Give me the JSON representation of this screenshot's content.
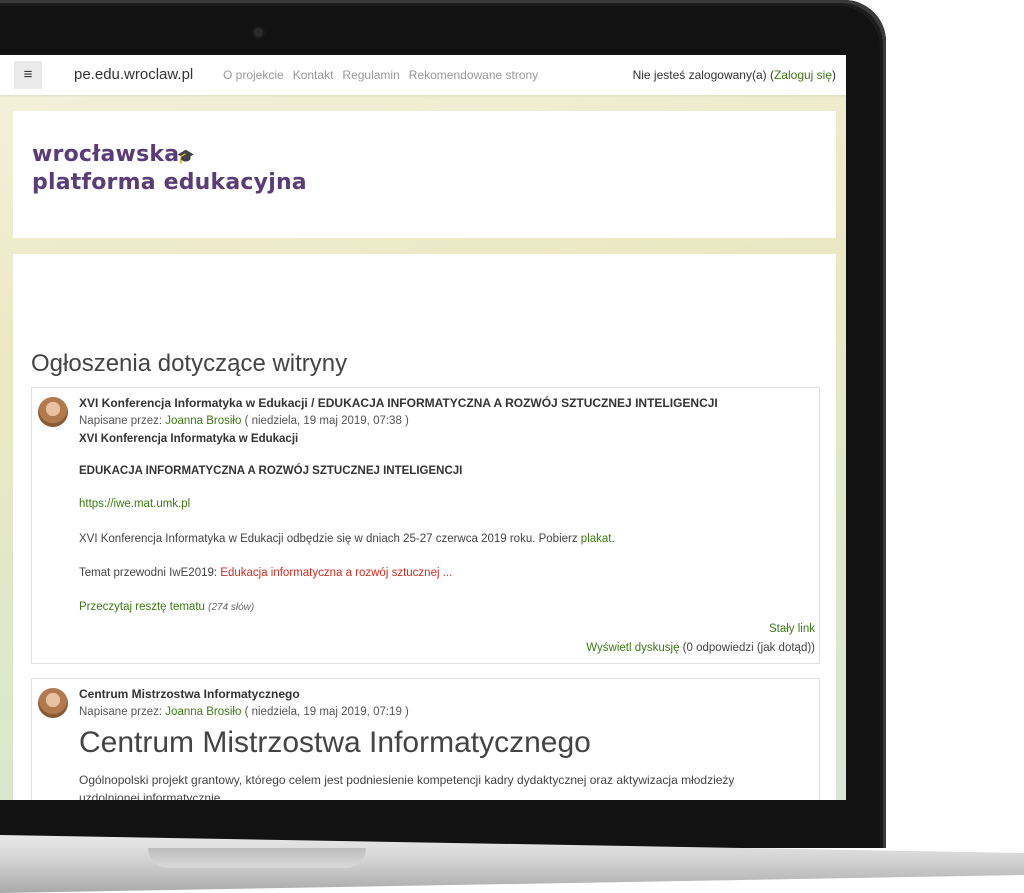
{
  "navbar": {
    "menu_icon": "≡",
    "brand": "pe.edu.wroclaw.pl",
    "links": [
      "O projekcie",
      "Kontakt",
      "Regulamin",
      "Rekomendowane strony"
    ],
    "login_prefix": "Nie jesteś zalogowany(a) (",
    "login_link": "Zaloguj się",
    "login_suffix": ")"
  },
  "logo": {
    "line1": "wrocławska",
    "line2": "platforma edukacyjna",
    "cap_icon": "🎓"
  },
  "section_title": "Ogłoszenia dotyczące witryny",
  "posts": [
    {
      "subject": "XVI Konferencja Informatyka w Edukacji / EDUKACJA INFORMATYCZNA A ROZWÓJ SZTUCZNEJ INTELIGENCJI",
      "by_prefix": "Napisane przez: ",
      "author": "Joanna Brosiło",
      "date": " ( niedziela, 19 maj 2019, 07:38 )",
      "heading1": "XVI Konferencja Informatyka w Edukacji",
      "heading2": "EDUKACJA INFORMATYCZNA A ROZWÓJ SZTUCZNEJ INTELIGENCJI",
      "url": "https://iwe.mat.umk.pl",
      "para_prefix": "XVI Konferencja Informatyka w Edukacji odbędzie się w dniach 25-27 czerwca 2019 roku. Pobierz ",
      "para_link": "plakat",
      "para_suffix": ".",
      "theme_prefix": "Temat przewodni IwE2019: ",
      "theme_link": "Edukacja informatyczna a rozwój sztucznej ...",
      "read_more": "Przeczytaj resztę tematu",
      "word_count": "(274 słów)",
      "permalink": "Stały link",
      "discussion_link": "Wyświetl dyskusję",
      "discussion_count": " (0 odpowiedzi (jak dotąd))"
    },
    {
      "subject": "Centrum Mistrzostwa Informatycznego",
      "by_prefix": "Napisane przez: ",
      "author": "Joanna Brosiło",
      "date": " ( niedziela, 19 maj 2019, 07:19 )",
      "heading": "Centrum Mistrzostwa Informatycznego",
      "para": "Ogólnopolski projekt grantowy, którego celem jest podniesienie kompetencji kadry dydaktycznej oraz aktywizacja młodzieży",
      "para2": "uzdolnionej informatycznie."
    }
  ]
}
